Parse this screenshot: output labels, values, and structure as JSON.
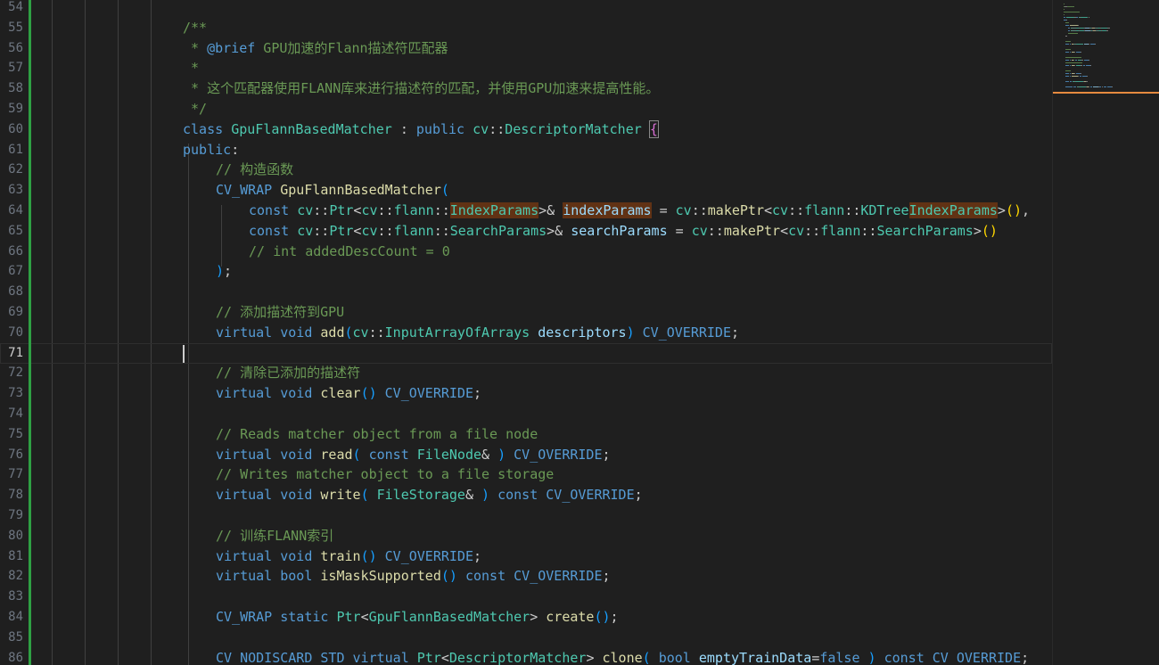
{
  "editor": {
    "current_line": 71,
    "lines": [
      {
        "n": "54",
        "indent": 0,
        "tokens": []
      },
      {
        "n": "55",
        "indent": 0,
        "tokens": [
          {
            "t": "/**",
            "c": "c-com"
          }
        ]
      },
      {
        "n": "56",
        "indent": 0,
        "tokens": [
          {
            "t": " * ",
            "c": "c-com"
          },
          {
            "t": "@brief",
            "c": "c-tag"
          },
          {
            "t": " GPU加速的Flann描述符匹配器",
            "c": "c-com"
          }
        ]
      },
      {
        "n": "57",
        "indent": 0,
        "tokens": [
          {
            "t": " *",
            "c": "c-com"
          }
        ]
      },
      {
        "n": "58",
        "indent": 0,
        "tokens": [
          {
            "t": " * 这个匹配器使用FLANN库来进行描述符的匹配，并使用GPU加速来提高性能。",
            "c": "c-com"
          }
        ]
      },
      {
        "n": "59",
        "indent": 0,
        "tokens": [
          {
            "t": " */",
            "c": "c-com"
          }
        ]
      },
      {
        "n": "60",
        "indent": 0,
        "tokens": [
          {
            "t": "class",
            "c": "c-kw"
          },
          {
            "t": " "
          },
          {
            "t": "GpuFlannBasedMatcher",
            "c": "c-ty"
          },
          {
            "t": " : "
          },
          {
            "t": "public",
            "c": "c-kw"
          },
          {
            "t": " "
          },
          {
            "t": "cv",
            "c": "c-ty"
          },
          {
            "t": "::"
          },
          {
            "t": "DescriptorMatcher",
            "c": "c-ty"
          },
          {
            "t": " "
          },
          {
            "t": "{",
            "c": "p2 bracket-box"
          }
        ]
      },
      {
        "n": "61",
        "indent": 0,
        "tokens": [
          {
            "t": "public",
            "c": "c-kw"
          },
          {
            "t": ":"
          }
        ]
      },
      {
        "n": "62",
        "indent": 1,
        "tokens": [
          {
            "t": "// 构造函数",
            "c": "c-com"
          }
        ]
      },
      {
        "n": "63",
        "indent": 1,
        "tokens": [
          {
            "t": "CV_WRAP",
            "c": "c-mac"
          },
          {
            "t": " "
          },
          {
            "t": "GpuFlannBasedMatcher",
            "c": "c-fn"
          },
          {
            "t": "(",
            "c": "p3"
          }
        ]
      },
      {
        "n": "64",
        "indent": 2,
        "tokens": [
          {
            "t": "const",
            "c": "c-kw"
          },
          {
            "t": " "
          },
          {
            "t": "cv",
            "c": "c-ty"
          },
          {
            "t": "::"
          },
          {
            "t": "Ptr",
            "c": "c-ty"
          },
          {
            "t": "<"
          },
          {
            "t": "cv",
            "c": "c-ty"
          },
          {
            "t": "::"
          },
          {
            "t": "flann",
            "c": "c-ty"
          },
          {
            "t": "::"
          },
          {
            "t": "IndexParams",
            "c": "c-ty hl"
          },
          {
            "t": ">& "
          },
          {
            "t": "indexParams",
            "c": "c-var hl"
          },
          {
            "t": " = "
          },
          {
            "t": "cv",
            "c": "c-ty"
          },
          {
            "t": "::"
          },
          {
            "t": "makePtr",
            "c": "c-fn"
          },
          {
            "t": "<"
          },
          {
            "t": "cv",
            "c": "c-ty"
          },
          {
            "t": "::"
          },
          {
            "t": "flann",
            "c": "c-ty"
          },
          {
            "t": "::"
          },
          {
            "t": "KDTree",
            "c": "c-ty"
          },
          {
            "t": "IndexParams",
            "c": "c-ty hl"
          },
          {
            "t": ">"
          },
          {
            "t": "()",
            "c": "p1"
          },
          {
            "t": ","
          }
        ]
      },
      {
        "n": "65",
        "indent": 2,
        "tokens": [
          {
            "t": "const",
            "c": "c-kw"
          },
          {
            "t": " "
          },
          {
            "t": "cv",
            "c": "c-ty"
          },
          {
            "t": "::"
          },
          {
            "t": "Ptr",
            "c": "c-ty"
          },
          {
            "t": "<"
          },
          {
            "t": "cv",
            "c": "c-ty"
          },
          {
            "t": "::"
          },
          {
            "t": "flann",
            "c": "c-ty"
          },
          {
            "t": "::"
          },
          {
            "t": "SearchParams",
            "c": "c-ty"
          },
          {
            "t": ">& "
          },
          {
            "t": "searchParams",
            "c": "c-var"
          },
          {
            "t": " = "
          },
          {
            "t": "cv",
            "c": "c-ty"
          },
          {
            "t": "::"
          },
          {
            "t": "makePtr",
            "c": "c-fn"
          },
          {
            "t": "<"
          },
          {
            "t": "cv",
            "c": "c-ty"
          },
          {
            "t": "::"
          },
          {
            "t": "flann",
            "c": "c-ty"
          },
          {
            "t": "::"
          },
          {
            "t": "SearchParams",
            "c": "c-ty"
          },
          {
            "t": ">"
          },
          {
            "t": "()",
            "c": "p1"
          }
        ]
      },
      {
        "n": "66",
        "indent": 2,
        "tokens": [
          {
            "t": "// int addedDescCount = 0",
            "c": "c-com"
          }
        ]
      },
      {
        "n": "67",
        "indent": 1,
        "tokens": [
          {
            "t": ")",
            "c": "p3"
          },
          {
            "t": ";"
          }
        ]
      },
      {
        "n": "68",
        "indent": 0,
        "tokens": []
      },
      {
        "n": "69",
        "indent": 1,
        "tokens": [
          {
            "t": "// 添加描述符到GPU",
            "c": "c-com"
          }
        ]
      },
      {
        "n": "70",
        "indent": 1,
        "tokens": [
          {
            "t": "virtual",
            "c": "c-kw"
          },
          {
            "t": " "
          },
          {
            "t": "void",
            "c": "c-kw"
          },
          {
            "t": " "
          },
          {
            "t": "add",
            "c": "c-fn"
          },
          {
            "t": "(",
            "c": "p3"
          },
          {
            "t": "cv",
            "c": "c-ty"
          },
          {
            "t": "::"
          },
          {
            "t": "InputArrayOfArrays",
            "c": "c-ty"
          },
          {
            "t": " "
          },
          {
            "t": "descriptors",
            "c": "c-var"
          },
          {
            "t": ")",
            "c": "p3"
          },
          {
            "t": " "
          },
          {
            "t": "CV_OVERRIDE",
            "c": "c-mac"
          },
          {
            "t": ";"
          }
        ]
      },
      {
        "n": "71",
        "indent": 0,
        "tokens": []
      },
      {
        "n": "72",
        "indent": 1,
        "tokens": [
          {
            "t": "// 清除已添加的描述符",
            "c": "c-com"
          }
        ]
      },
      {
        "n": "73",
        "indent": 1,
        "tokens": [
          {
            "t": "virtual",
            "c": "c-kw"
          },
          {
            "t": " "
          },
          {
            "t": "void",
            "c": "c-kw"
          },
          {
            "t": " "
          },
          {
            "t": "clear",
            "c": "c-fn"
          },
          {
            "t": "()",
            "c": "p3"
          },
          {
            "t": " "
          },
          {
            "t": "CV_OVERRIDE",
            "c": "c-mac"
          },
          {
            "t": ";"
          }
        ]
      },
      {
        "n": "74",
        "indent": 0,
        "tokens": []
      },
      {
        "n": "75",
        "indent": 1,
        "tokens": [
          {
            "t": "// Reads matcher object from a file node",
            "c": "c-com"
          }
        ]
      },
      {
        "n": "76",
        "indent": 1,
        "tokens": [
          {
            "t": "virtual",
            "c": "c-kw"
          },
          {
            "t": " "
          },
          {
            "t": "void",
            "c": "c-kw"
          },
          {
            "t": " "
          },
          {
            "t": "read",
            "c": "c-fn"
          },
          {
            "t": "(",
            "c": "p3"
          },
          {
            "t": " "
          },
          {
            "t": "const",
            "c": "c-kw"
          },
          {
            "t": " "
          },
          {
            "t": "FileNode",
            "c": "c-ty"
          },
          {
            "t": "& "
          },
          {
            "t": ")",
            "c": "p3"
          },
          {
            "t": " "
          },
          {
            "t": "CV_OVERRIDE",
            "c": "c-mac"
          },
          {
            "t": ";"
          }
        ]
      },
      {
        "n": "77",
        "indent": 1,
        "tokens": [
          {
            "t": "// Writes matcher object to a file storage",
            "c": "c-com"
          }
        ]
      },
      {
        "n": "78",
        "indent": 1,
        "tokens": [
          {
            "t": "virtual",
            "c": "c-kw"
          },
          {
            "t": " "
          },
          {
            "t": "void",
            "c": "c-kw"
          },
          {
            "t": " "
          },
          {
            "t": "write",
            "c": "c-fn"
          },
          {
            "t": "(",
            "c": "p3"
          },
          {
            "t": " "
          },
          {
            "t": "FileStorage",
            "c": "c-ty"
          },
          {
            "t": "& "
          },
          {
            "t": ")",
            "c": "p3"
          },
          {
            "t": " "
          },
          {
            "t": "const",
            "c": "c-kw"
          },
          {
            "t": " "
          },
          {
            "t": "CV_OVERRIDE",
            "c": "c-mac"
          },
          {
            "t": ";"
          }
        ]
      },
      {
        "n": "79",
        "indent": 0,
        "tokens": []
      },
      {
        "n": "80",
        "indent": 1,
        "tokens": [
          {
            "t": "// 训练FLANN索引",
            "c": "c-com"
          }
        ]
      },
      {
        "n": "81",
        "indent": 1,
        "tokens": [
          {
            "t": "virtual",
            "c": "c-kw"
          },
          {
            "t": " "
          },
          {
            "t": "void",
            "c": "c-kw"
          },
          {
            "t": " "
          },
          {
            "t": "train",
            "c": "c-fn"
          },
          {
            "t": "()",
            "c": "p3"
          },
          {
            "t": " "
          },
          {
            "t": "CV_OVERRIDE",
            "c": "c-mac"
          },
          {
            "t": ";"
          }
        ]
      },
      {
        "n": "82",
        "indent": 1,
        "tokens": [
          {
            "t": "virtual",
            "c": "c-kw"
          },
          {
            "t": " "
          },
          {
            "t": "bool",
            "c": "c-kw"
          },
          {
            "t": " "
          },
          {
            "t": "isMaskSupported",
            "c": "c-fn"
          },
          {
            "t": "()",
            "c": "p3"
          },
          {
            "t": " "
          },
          {
            "t": "const",
            "c": "c-kw"
          },
          {
            "t": " "
          },
          {
            "t": "CV_OVERRIDE",
            "c": "c-mac"
          },
          {
            "t": ";"
          }
        ]
      },
      {
        "n": "83",
        "indent": 0,
        "tokens": []
      },
      {
        "n": "84",
        "indent": 1,
        "tokens": [
          {
            "t": "CV_WRAP",
            "c": "c-mac"
          },
          {
            "t": " "
          },
          {
            "t": "static",
            "c": "c-kw"
          },
          {
            "t": " "
          },
          {
            "t": "Ptr",
            "c": "c-ty"
          },
          {
            "t": "<"
          },
          {
            "t": "GpuFlannBasedMatcher",
            "c": "c-ty"
          },
          {
            "t": "> "
          },
          {
            "t": "create",
            "c": "c-fn"
          },
          {
            "t": "()",
            "c": "p3"
          },
          {
            "t": ";"
          }
        ]
      },
      {
        "n": "85",
        "indent": 0,
        "tokens": []
      },
      {
        "n": "86",
        "indent": 1,
        "tokens": [
          {
            "t": "CV_NODISCARD_STD",
            "c": "c-mac"
          },
          {
            "t": " "
          },
          {
            "t": "virtual",
            "c": "c-kw"
          },
          {
            "t": " "
          },
          {
            "t": "Ptr",
            "c": "c-ty"
          },
          {
            "t": "<"
          },
          {
            "t": "DescriptorMatcher",
            "c": "c-ty"
          },
          {
            "t": "> "
          },
          {
            "t": "clone",
            "c": "c-fn"
          },
          {
            "t": "(",
            "c": "p3"
          },
          {
            "t": " "
          },
          {
            "t": "bool",
            "c": "c-kw"
          },
          {
            "t": " "
          },
          {
            "t": "emptyTrainData",
            "c": "c-var"
          },
          {
            "t": "="
          },
          {
            "t": "false",
            "c": "c-kw"
          },
          {
            "t": " "
          },
          {
            "t": ")",
            "c": "p3"
          },
          {
            "t": " "
          },
          {
            "t": "const",
            "c": "c-kw"
          },
          {
            "t": " "
          },
          {
            "t": "CV_OVERRIDE",
            "c": "c-mac"
          },
          {
            "t": ";"
          }
        ]
      }
    ]
  },
  "colors": {
    "background": "#1f1f1f",
    "comment": "#6a9955",
    "keyword": "#569cd6",
    "type": "#4ec9b0",
    "function": "#dcdcaa",
    "variable": "#9cdcfe",
    "highlight": "#613214",
    "git_added": "#2ea043"
  },
  "minimap": {
    "label": "minimap",
    "caret_line": 71
  }
}
